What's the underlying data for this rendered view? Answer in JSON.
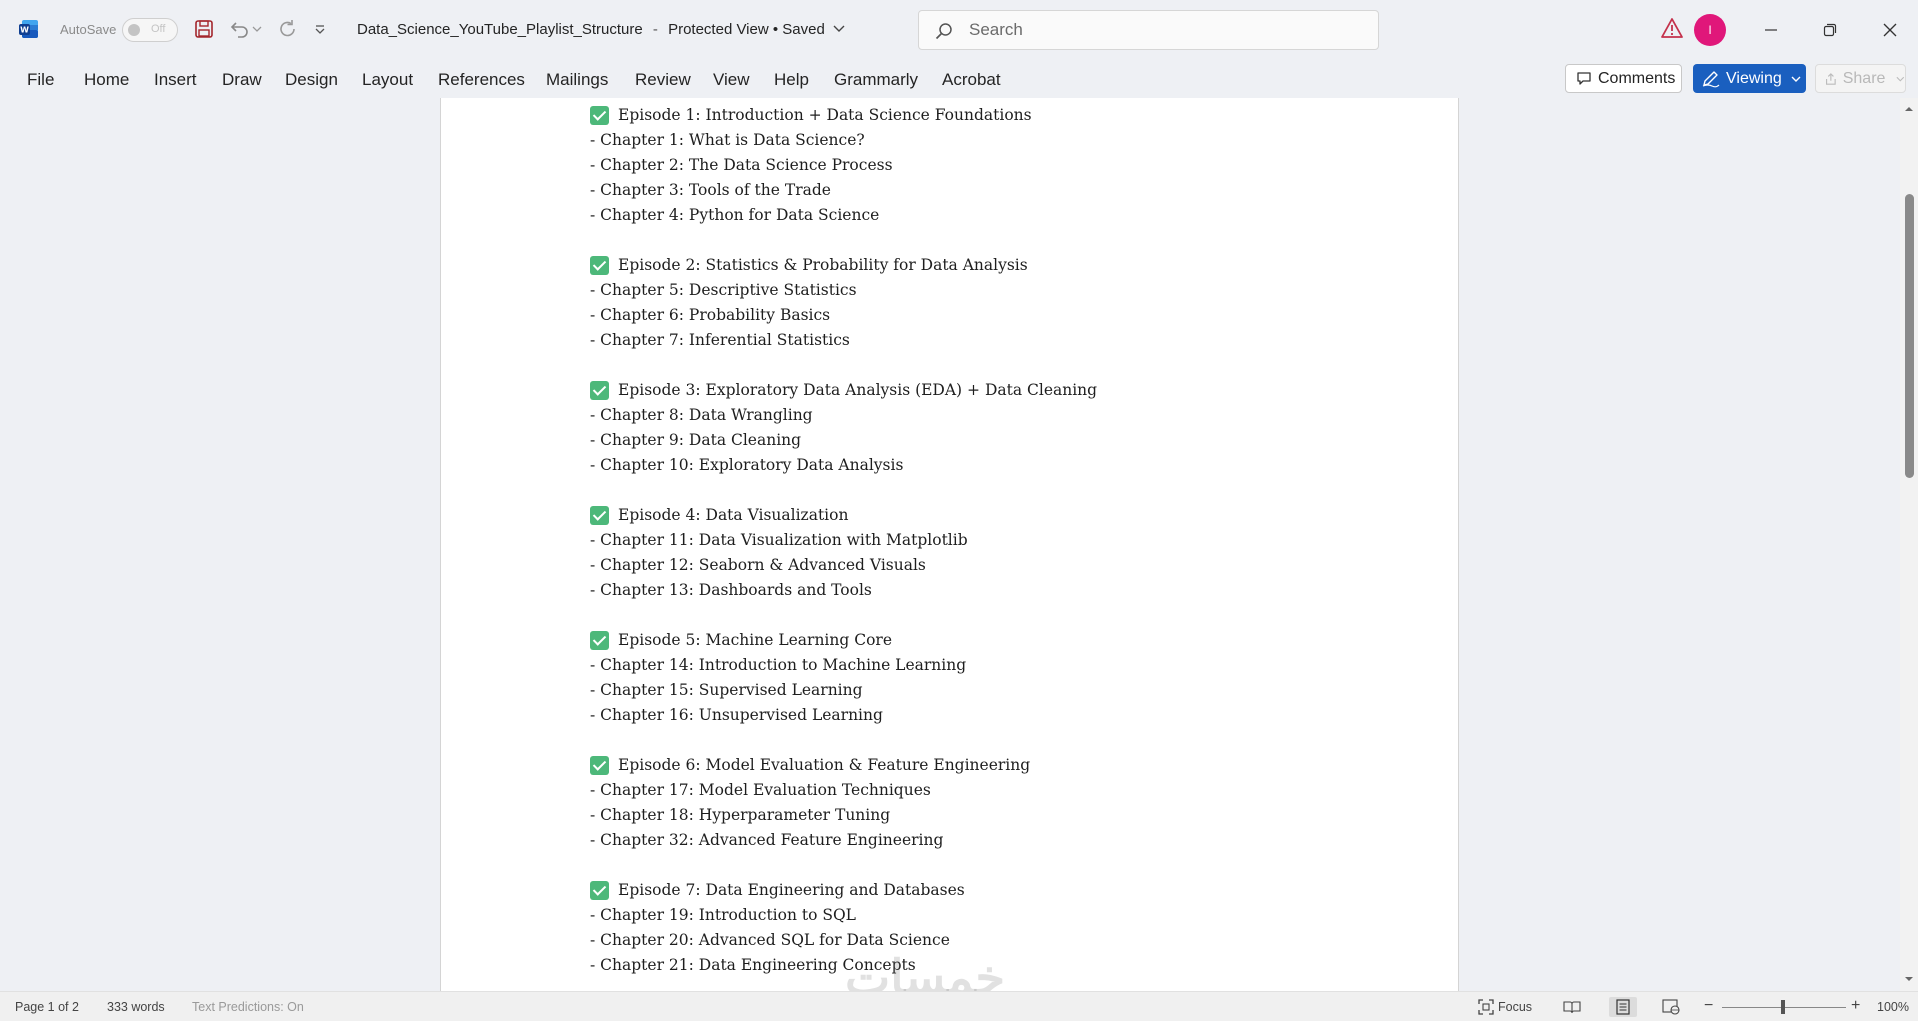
{
  "titlebar": {
    "autosave_label": "AutoSave",
    "autosave_state": "Off",
    "document_name": "Data_Science_YouTube_Playlist_Structure",
    "view_mode": "Protected View",
    "save_state": "Saved",
    "search_placeholder": "Search",
    "avatar_initial": "I"
  },
  "ribbon": {
    "tabs": [
      "File",
      "Home",
      "Insert",
      "Draw",
      "Design",
      "Layout",
      "References",
      "Mailings",
      "Review",
      "View",
      "Help",
      "Grammarly",
      "Acrobat"
    ],
    "comments_label": "Comments",
    "viewing_label": "Viewing",
    "share_label": "Share"
  },
  "document": {
    "episodes": [
      {
        "title": "Episode 1: Introduction + Data Science Foundations",
        "chapters": [
          "- Chapter 1: What is Data Science?",
          "- Chapter 2: The Data Science Process",
          "- Chapter 3: Tools of the Trade",
          "- Chapter 4: Python for Data Science"
        ]
      },
      {
        "title": "Episode 2: Statistics & Probability for Data Analysis",
        "chapters": [
          "- Chapter 5: Descriptive Statistics",
          "- Chapter 6: Probability Basics",
          "- Chapter 7: Inferential Statistics"
        ]
      },
      {
        "title": "Episode 3: Exploratory Data Analysis (EDA) + Data Cleaning",
        "chapters": [
          "- Chapter 8: Data Wrangling",
          "- Chapter 9: Data Cleaning",
          "- Chapter 10: Exploratory Data Analysis"
        ]
      },
      {
        "title": "Episode 4: Data Visualization",
        "chapters": [
          "- Chapter 11: Data Visualization with Matplotlib",
          "- Chapter 12: Seaborn & Advanced Visuals",
          "- Chapter 13: Dashboards and Tools"
        ]
      },
      {
        "title": "Episode 5: Machine Learning Core",
        "chapters": [
          "- Chapter 14: Introduction to Machine Learning",
          "- Chapter 15: Supervised Learning",
          "- Chapter 16: Unsupervised Learning"
        ]
      },
      {
        "title": "Episode 6: Model Evaluation & Feature Engineering",
        "chapters": [
          "- Chapter 17: Model Evaluation Techniques",
          "- Chapter 18: Hyperparameter Tuning",
          "- Chapter 32: Advanced Feature Engineering"
        ]
      },
      {
        "title": "Episode 7: Data Engineering and Databases",
        "chapters": [
          "- Chapter 19: Introduction to SQL",
          "- Chapter 20: Advanced SQL for Data Science",
          "- Chapter 21: Data Engineering Concepts"
        ]
      }
    ]
  },
  "statusbar": {
    "page": "Page 1 of 2",
    "words": "333 words",
    "text_predictions": "Text Predictions: On",
    "focus_label": "Focus",
    "zoom": "100%",
    "zoom_minus": "−",
    "zoom_plus": "+"
  },
  "watermark": "خمسات",
  "colors": {
    "accent": "#1a5fbf",
    "avatar": "#e0177a",
    "checkmark": "#4db87a",
    "warning": "#c4314b"
  }
}
